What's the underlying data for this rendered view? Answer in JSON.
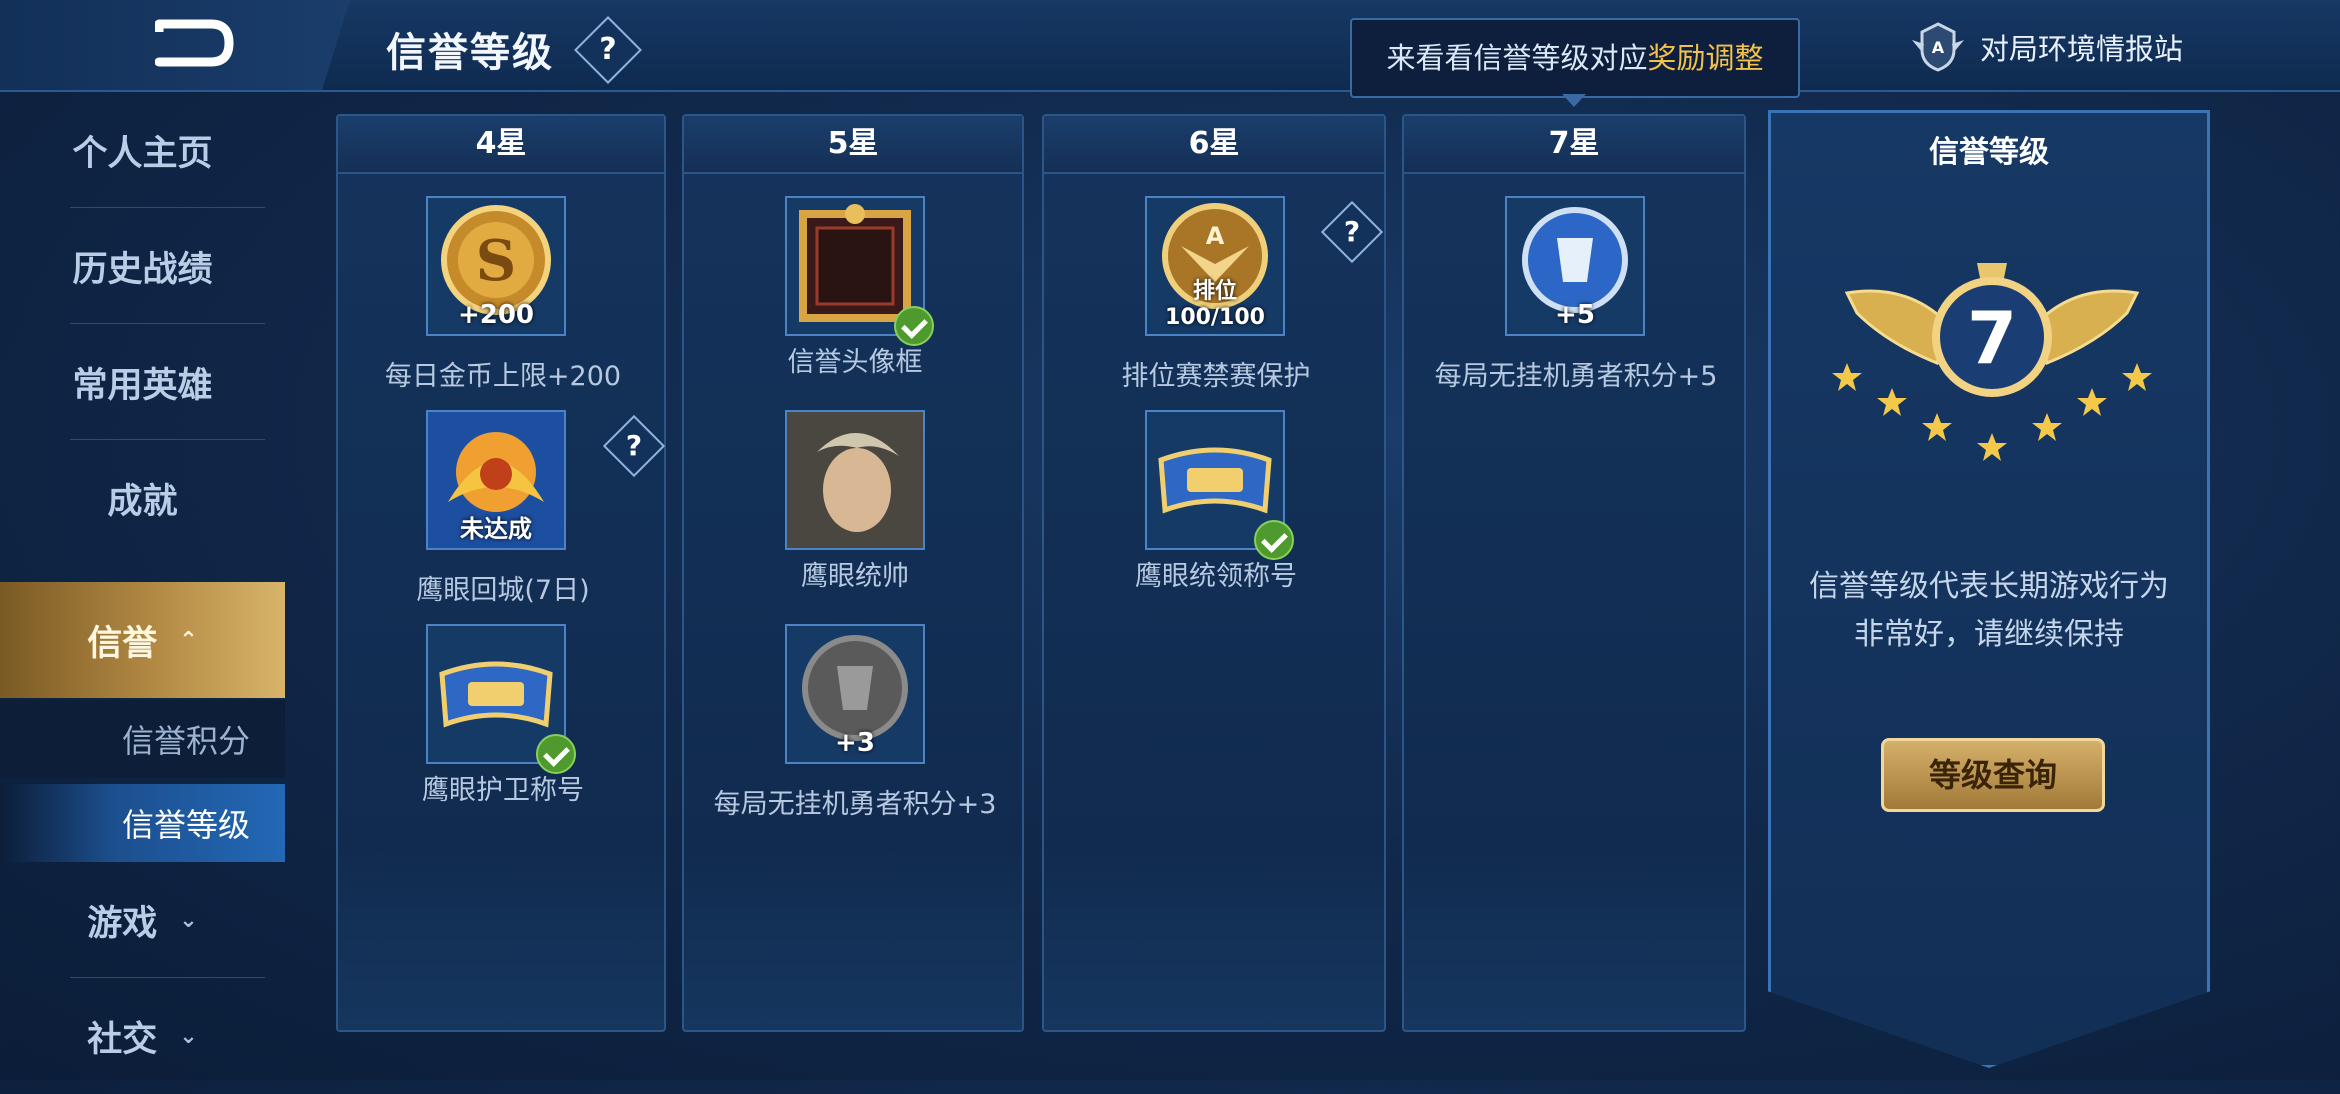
{
  "header": {
    "title": "信誉等级",
    "help_glyph": "?",
    "tooltip_prefix": "来看看信誉等级对应",
    "tooltip_highlight": "奖励调整",
    "report_link": "对局环境情报站"
  },
  "sidebar": {
    "items": [
      {
        "label": "个人主页"
      },
      {
        "label": "历史战绩"
      },
      {
        "label": "常用英雄"
      },
      {
        "label": "成就"
      },
      {
        "label": "信誉"
      },
      {
        "label": "游戏"
      },
      {
        "label": "社交"
      }
    ],
    "sub_items": [
      {
        "label": "信誉积分"
      },
      {
        "label": "信誉等级"
      }
    ]
  },
  "columns": [
    {
      "title": "4星",
      "rewards": [
        {
          "caption": "每日金币上限+200",
          "badge": "+200",
          "icon": "gold-coin-icon",
          "claimed": false
        },
        {
          "caption": "鹰眼回城(7日)",
          "badge": "未达成",
          "icon": "eagle-recall-icon",
          "claimed": false,
          "has_help": true
        },
        {
          "caption": "鹰眼护卫称号",
          "badge": "",
          "icon": "title-scroll-icon",
          "claimed": true
        }
      ]
    },
    {
      "title": "5星",
      "rewards": [
        {
          "caption": "信誉头像框",
          "badge": "",
          "icon": "avatar-frame-icon",
          "claimed": true
        },
        {
          "caption": "鹰眼统帅",
          "badge": "",
          "icon": "hero-portrait-icon",
          "claimed": false
        },
        {
          "caption": "每局无挂机勇者积分+3",
          "badge": "+3",
          "icon": "hero-points-icon",
          "claimed": false
        }
      ]
    },
    {
      "title": "6星",
      "rewards": [
        {
          "caption": "排位赛禁赛保护",
          "badge": "排位100/100",
          "icon": "rank-shield-icon",
          "claimed": false,
          "has_help": true
        },
        {
          "caption": "鹰眼统领称号",
          "badge": "",
          "icon": "title-scroll-icon",
          "claimed": true
        }
      ]
    },
    {
      "title": "7星",
      "rewards": [
        {
          "caption": "每局无挂机勇者积分+5",
          "badge": "+5",
          "icon": "hero-points-icon",
          "claimed": false
        }
      ]
    }
  ],
  "rank_panel": {
    "title": "信誉等级",
    "level": "7",
    "desc_line1": "信誉等级代表长期游戏行为",
    "desc_line2": "非常好，请继续保持",
    "button": "等级查询"
  },
  "colors": {
    "gold": "#f2c14e",
    "panel_border": "#2a5688",
    "active_nav": "#b38a44",
    "active_sub": "#2368b6",
    "check_green": "#4e9a2e"
  }
}
